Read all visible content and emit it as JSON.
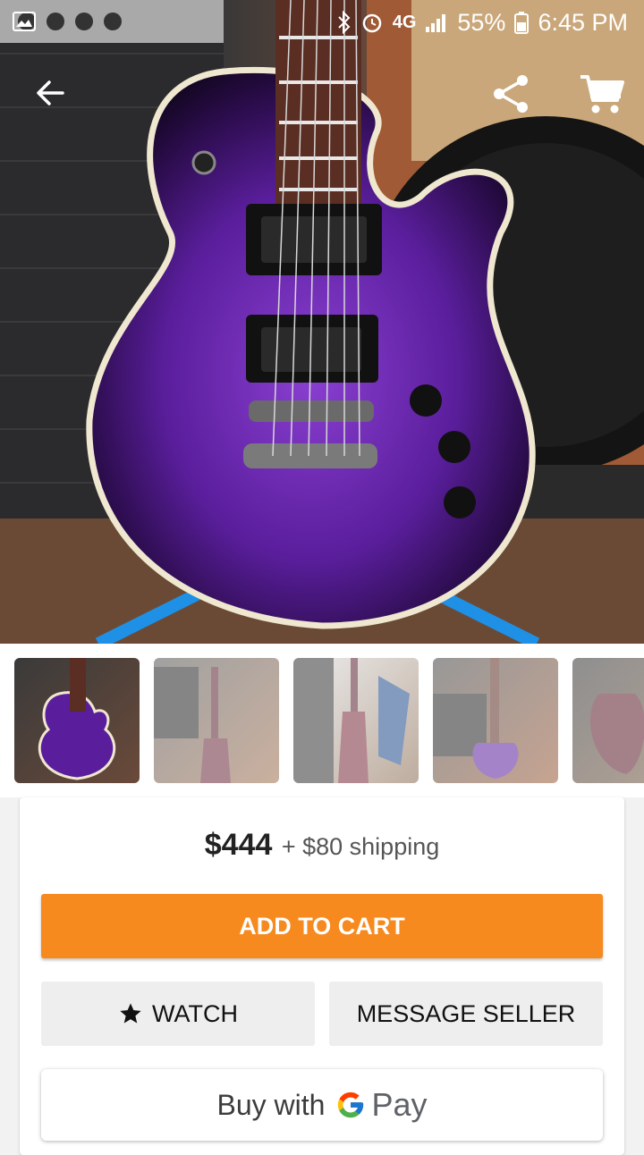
{
  "status_bar": {
    "network": "4G",
    "battery": "55%",
    "time": "6:45 PM"
  },
  "toolbar": {
    "back_icon": "arrow-left-icon",
    "share_icon": "share-icon",
    "cart_icon": "shopping-cart-icon"
  },
  "gallery": {
    "thumbnail_count": 5,
    "selected_index": 0
  },
  "listing": {
    "price": "$444",
    "shipping": "+ $80 shipping"
  },
  "actions": {
    "add_to_cart": "ADD TO CART",
    "watch": "WATCH",
    "message_seller": "MESSAGE SELLER",
    "buy_with": "Buy with",
    "pay": "Pay"
  },
  "colors": {
    "accent": "#f68a1e",
    "button_grey": "#eeeeee"
  }
}
